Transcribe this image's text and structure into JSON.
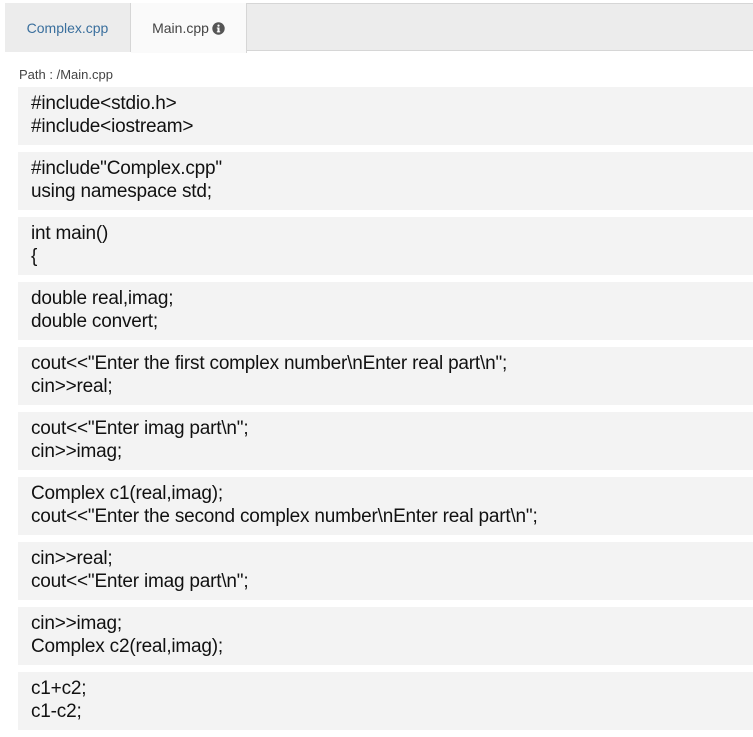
{
  "tabs": [
    {
      "label": "Complex.cpp",
      "active": false
    },
    {
      "label": "Main.cpp",
      "active": true,
      "icon": "info-icon"
    }
  ],
  "path": "Path : /Main.cpp",
  "code_blocks": [
    [
      "#include<stdio.h>",
      "#include<iostream>"
    ],
    [
      "#include\"Complex.cpp\"",
      "using namespace std;"
    ],
    [
      "int main()",
      "{"
    ],
    [
      "double real,imag;",
      "double convert;"
    ],
    [
      "cout<<\"Enter the first complex number\\nEnter real part\\n\";",
      "cin>>real;"
    ],
    [
      "cout<<\"Enter imag part\\n\";",
      "cin>>imag;"
    ],
    [
      "Complex c1(real,imag);",
      "cout<<\"Enter the second complex number\\nEnter real part\\n\";"
    ],
    [
      "cin>>real;",
      "cout<<\"Enter imag part\\n\";"
    ],
    [
      "cin>>imag;",
      "Complex c2(real,imag);"
    ],
    [
      "c1+c2;",
      "c1-c2;"
    ]
  ],
  "colors": {
    "tab_link": "#3a6f9d",
    "tab_bar": "#ececec",
    "code_bg": "#f3f3f3"
  }
}
